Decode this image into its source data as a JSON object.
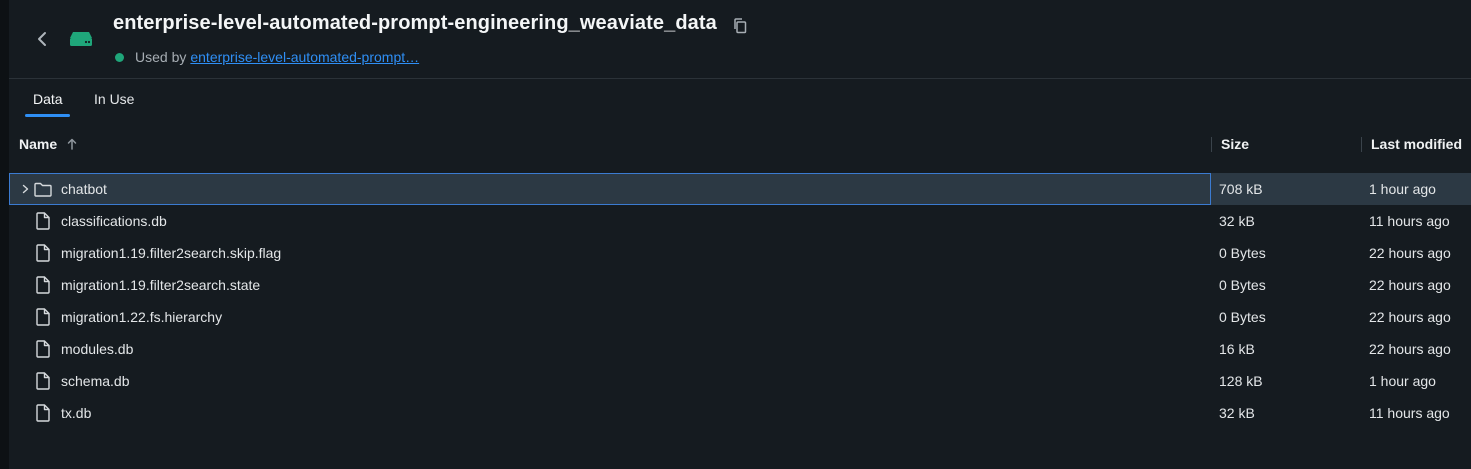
{
  "header": {
    "title": "enterprise-level-automated-prompt-engineering_weaviate_data",
    "used_by_prefix": "Used by",
    "used_by_link": "enterprise-level-automated-prompt…",
    "status_color": "#1fa67a",
    "icons": {
      "back": "chevron-left-icon",
      "volume": "storage-volume-icon",
      "copy": "copy-icon"
    }
  },
  "tabs": [
    {
      "label": "Data",
      "active": true
    },
    {
      "label": "In Use",
      "active": false
    }
  ],
  "table": {
    "columns": {
      "name": "Name",
      "size": "Size",
      "modified": "Last modified"
    },
    "sort": "name ascending",
    "rows": [
      {
        "name": "chatbot",
        "size": "708 kB",
        "modified": "1 hour ago",
        "type": "folder",
        "selected": true
      },
      {
        "name": "classifications.db",
        "size": "32 kB",
        "modified": "11 hours ago",
        "type": "file"
      },
      {
        "name": "migration1.19.filter2search.skip.flag",
        "size": "0 Bytes",
        "modified": "22 hours ago",
        "type": "file"
      },
      {
        "name": "migration1.19.filter2search.state",
        "size": "0 Bytes",
        "modified": "22 hours ago",
        "type": "file"
      },
      {
        "name": "migration1.22.fs.hierarchy",
        "size": "0 Bytes",
        "modified": "22 hours ago",
        "type": "file"
      },
      {
        "name": "modules.db",
        "size": "16 kB",
        "modified": "22 hours ago",
        "type": "file"
      },
      {
        "name": "schema.db",
        "size": "128 kB",
        "modified": "1 hour ago",
        "type": "file"
      },
      {
        "name": "tx.db",
        "size": "32 kB",
        "modified": "11 hours ago",
        "type": "file"
      }
    ]
  },
  "colors": {
    "accent": "#2f8ff5",
    "background": "#151b20",
    "selected_row": "#2c3944"
  }
}
